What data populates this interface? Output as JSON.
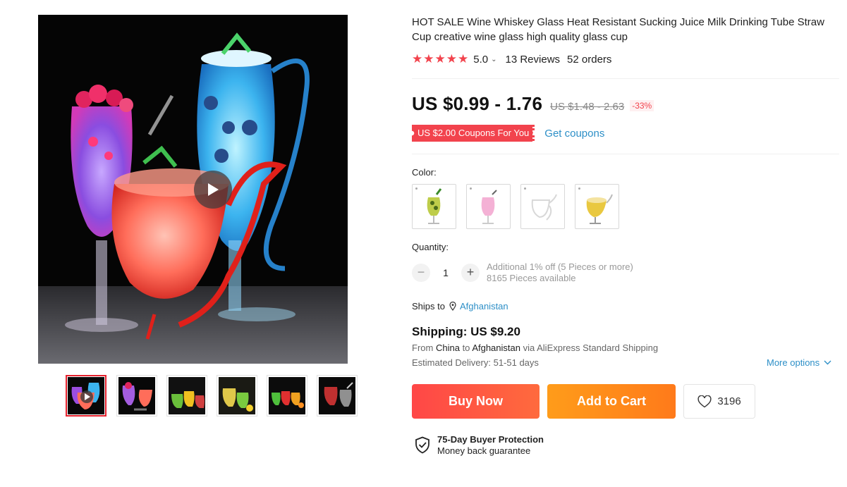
{
  "product": {
    "title": "HOT SALE Wine Whiskey Glass Heat Resistant Sucking Juice Milk Drinking Tube Straw Cup creative wine glass high quality glass cup",
    "rating": {
      "stars": 5,
      "value": "5.0",
      "reviews": "13 Reviews",
      "orders": "52 orders"
    },
    "price": {
      "current": "US $0.99 - 1.76",
      "original": "US $1.48 - 2.63",
      "discount": "-33%"
    },
    "coupon": {
      "tag": "US $2.00 Coupons For You",
      "link": "Get coupons"
    },
    "color": {
      "label": "Color:",
      "options": [
        "green-yellow glass",
        "pink glass",
        "clear glass",
        "amber glass"
      ]
    },
    "quantity": {
      "label": "Quantity:",
      "minus": "−",
      "plus": "+",
      "value": "1",
      "discount_note": "Additional 1% off (5 Pieces or more)",
      "available": "8165 Pieces available"
    },
    "ships_to": {
      "label": "Ships to",
      "country": "Afghanistan"
    },
    "shipping": {
      "title": "Shipping: US $9.20",
      "from_prefix": "From",
      "from_country": "China",
      "to_word": "to",
      "to_country": "Afghanistan",
      "via": "via AliExpress Standard Shipping",
      "delivery": "Estimated Delivery: 51-51 days",
      "more_options": "More options"
    },
    "actions": {
      "buy_now": "Buy Now",
      "add_to_cart": "Add to Cart",
      "wishlist_count": "3196"
    },
    "protection": {
      "title": "75-Day Buyer Protection",
      "subtitle": "Money back guarantee"
    }
  },
  "gallery": {
    "thumbnail_count": 6,
    "active_thumbnail": 0,
    "has_video": true
  },
  "colors": {
    "accent_red": "#f2434d",
    "link_blue": "#2d8fc7",
    "buy_now": "#ff4747",
    "add_to_cart": "#ff9c1a"
  }
}
